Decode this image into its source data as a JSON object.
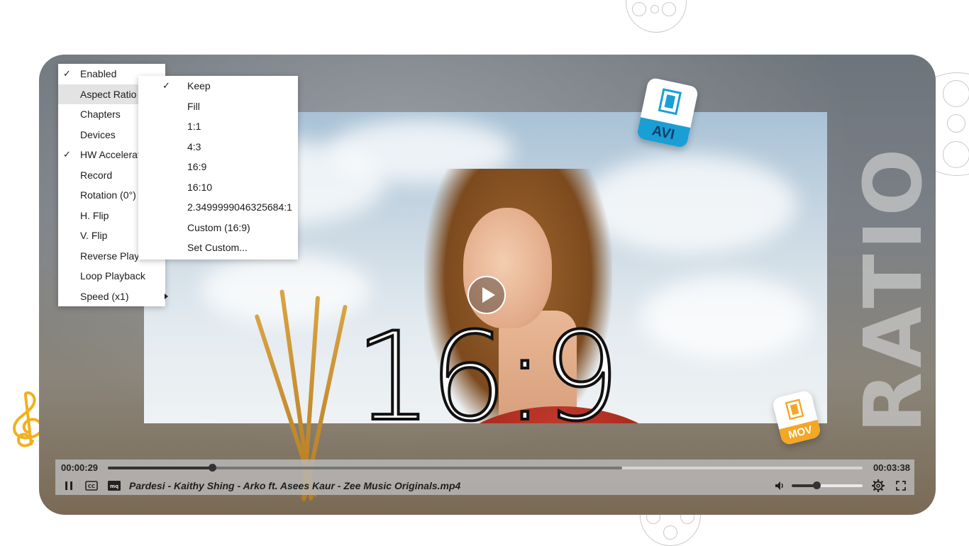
{
  "main_menu": [
    {
      "label": "Enabled",
      "checked": true,
      "submenu": false
    },
    {
      "label": "Aspect Ratio",
      "checked": false,
      "submenu": true,
      "highlighted": true
    },
    {
      "label": "Chapters",
      "checked": false,
      "submenu": false
    },
    {
      "label": "Devices",
      "checked": false,
      "submenu": true
    },
    {
      "label": "HW Acceleration",
      "checked": true,
      "submenu": false
    },
    {
      "label": "Record",
      "checked": false,
      "submenu": false
    },
    {
      "label": "Rotation (0°)",
      "checked": false,
      "submenu": true
    },
    {
      "label": "H. Flip",
      "checked": false,
      "submenu": false
    },
    {
      "label": "V. Flip",
      "checked": false,
      "submenu": false
    },
    {
      "label": "Reverse Playback",
      "checked": false,
      "submenu": false
    },
    {
      "label": "Loop Playback",
      "checked": false,
      "submenu": false
    },
    {
      "label": "Speed (x1)",
      "checked": false,
      "submenu": true
    }
  ],
  "aspect_menu": [
    {
      "label": "Keep",
      "checked": true
    },
    {
      "label": "Fill",
      "checked": false
    },
    {
      "label": "1:1",
      "checked": false
    },
    {
      "label": "4:3",
      "checked": false
    },
    {
      "label": "16:9",
      "checked": false
    },
    {
      "label": "16:10",
      "checked": false
    },
    {
      "label": "2.3499999046325684:1",
      "checked": false
    },
    {
      "label": "Custom (16:9)",
      "checked": false
    },
    {
      "label": "Set Custom...",
      "checked": false
    }
  ],
  "overlay": {
    "big_ratio": "16:9",
    "side_word": "RATIO",
    "badge_avi": "AVI",
    "badge_mov": "MOV"
  },
  "player": {
    "current_time": "00:00:29",
    "total_time": "00:03:38",
    "progress_fraction": 0.138,
    "buffered_fraction": 0.681,
    "volume_fraction": 0.35,
    "filename": "Pardesi - Kaithy Shing - Arko ft. Asees Kaur - Zee Music Originals.mp4"
  },
  "icons": {
    "pause": "pause-icon",
    "cc": "closed-captions-icon",
    "mq": "media-quality-icon",
    "volume": "volume-icon",
    "settings": "gear-icon",
    "fullscreen": "fullscreen-icon",
    "play": "play-icon",
    "music": "treble-clef-icon"
  },
  "colors": {
    "accent_blue": "#1a9fd4",
    "accent_orange": "#f5a623",
    "clef": "#f2b01e"
  }
}
